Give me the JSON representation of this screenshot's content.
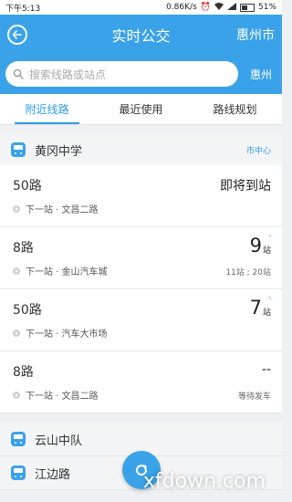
{
  "status_bar": {
    "time": "下午5:13",
    "speed": "0.86K/s",
    "battery": "51%"
  },
  "header": {
    "title": "实时公交",
    "city": "惠州市"
  },
  "search": {
    "placeholder": "搜索线路或站点",
    "city": "惠州"
  },
  "tabs": [
    {
      "label": "附近线路",
      "active": true
    },
    {
      "label": "最近使用",
      "active": false
    },
    {
      "label": "路线规划",
      "active": false
    }
  ],
  "stops": [
    {
      "name": "黄冈中学",
      "direction": "市中心",
      "lines": [
        {
          "name": "50路",
          "next": "下一站 · 文昌二路",
          "eta_text": "即将到站"
        },
        {
          "name": "8路",
          "next": "下一站 · 金山汽车城",
          "eta_num": "9",
          "eta_unit": "站",
          "sub": "11站 ; 20站"
        },
        {
          "name": "50路",
          "next": "下一站 · 汽车大市场",
          "eta_num": "7",
          "eta_unit": "站"
        },
        {
          "name": "8路",
          "next": "下一站 · 文昌二路",
          "eta_text": "--",
          "sub": "等待发车"
        }
      ]
    },
    {
      "name": "云山中队"
    },
    {
      "name": "江边路"
    }
  ],
  "watermark": "xfdown.com",
  "colors": {
    "accent": "#3aa2e8",
    "tab_active": "#2e9be6"
  }
}
